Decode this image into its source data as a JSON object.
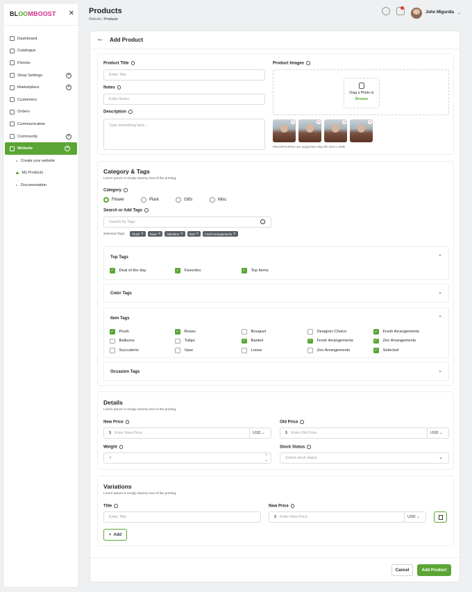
{
  "app": {
    "logo_parts": [
      "BL",
      "OO",
      "MBOOST"
    ],
    "close_icon": "close-icon"
  },
  "sidebar": {
    "items": [
      {
        "label": "Dashboard",
        "icon": "grid-icon",
        "expandable": false
      },
      {
        "label": "Catalogue",
        "icon": "box-icon",
        "expandable": false
      },
      {
        "label": "Florists",
        "icon": "user-icon",
        "expandable": false
      },
      {
        "label": "Shop Settings",
        "icon": "gear-icon",
        "expandable": true
      },
      {
        "label": "Marketplace",
        "icon": "store-icon",
        "expandable": true
      },
      {
        "label": "Customers",
        "icon": "users-icon",
        "expandable": false
      },
      {
        "label": "Orders",
        "icon": "clipboard-icon",
        "expandable": false
      },
      {
        "label": "Communication",
        "icon": "chat-icon",
        "expandable": false
      },
      {
        "label": "Community",
        "icon": "megaphone-icon",
        "expandable": true
      },
      {
        "label": "Website",
        "icon": "globe-icon",
        "expandable": true,
        "active": true
      }
    ],
    "subitems": [
      {
        "label": "Create your website"
      },
      {
        "label": "My Products",
        "current": true
      },
      {
        "label": "Documentation"
      }
    ]
  },
  "header": {
    "title": "Products",
    "breadcrumb_root": "Website",
    "breadcrumb_sep": "/",
    "breadcrumb_current": "Products",
    "user_name": "John Migurdia",
    "accent": "#5aa534"
  },
  "page": {
    "back_icon": "arrow-left-icon",
    "title": "Add Product"
  },
  "product": {
    "title_label": "Product Title",
    "title_placeholder": "Enter Title",
    "notes_label": "Notes",
    "notes_placeholder": "Enter Notes",
    "desc_label": "Description",
    "desc_placeholder": "Type something here...",
    "images_label": "Product Images",
    "drop_text": "Drag a Photo or",
    "browse": "Browse",
    "images_hint": "PNG/JPG/JPEG are supported. Max file size is 2MB"
  },
  "category": {
    "title": "Category & Tags",
    "subtitle": "Lorem Ipsum is simply dummy text of the printing.",
    "category_label": "Category",
    "options": [
      {
        "label": "Flower",
        "selected": true
      },
      {
        "label": "Plant"
      },
      {
        "label": "Gifts"
      },
      {
        "label": "Misc"
      }
    ],
    "search_label": "Search or Add Tags",
    "search_placeholder": "Search by Tags",
    "selected_label": "Selected Tags:",
    "selected_tags": [
      "Plush",
      "Rose",
      "Valentine",
      "Red",
      "Fresh Arrangements"
    ],
    "top_tags_title": "Top Tags",
    "top_tags": [
      {
        "label": "Deal of the day",
        "checked": true
      },
      {
        "label": "Favorites",
        "checked": true
      },
      {
        "label": "Top Items",
        "checked": true
      }
    ],
    "color_tags_title": "Color Tags",
    "item_tags_title": "Item Tags",
    "item_tags": [
      {
        "label": "Plush",
        "checked": true
      },
      {
        "label": "Roses",
        "checked": true
      },
      {
        "label": "Bouquet",
        "checked": false
      },
      {
        "label": "Designer Choice",
        "checked": false
      },
      {
        "label": "Fresh Arrangements",
        "checked": true
      },
      {
        "label": "Balloons",
        "checked": false
      },
      {
        "label": "Tulips",
        "checked": false
      },
      {
        "label": "Basket",
        "checked": true
      },
      {
        "label": "Fresh Arrangements",
        "checked": true
      },
      {
        "label": "Zen Arrangements",
        "checked": true
      },
      {
        "label": "Succulents",
        "checked": false
      },
      {
        "label": "Vase",
        "checked": false
      },
      {
        "label": "Loose",
        "checked": false
      },
      {
        "label": "Zen Arrangements",
        "checked": false
      },
      {
        "label": "Selected",
        "checked": true
      }
    ],
    "occasion_tags_title": "Occasion Tags"
  },
  "details": {
    "title": "Details",
    "subtitle": "Lorem Ipsum is simply dummy text of the printing.",
    "new_price_label": "New Price",
    "new_price_placeholder": "Enter New Price",
    "old_price_label": "Old Price",
    "old_price_placeholder": "Enter Old Price",
    "currency_symbol": "$",
    "currency": "USD",
    "weight_label": "Weight",
    "weight_value": "4",
    "stock_label": "Stock Status",
    "stock_placeholder": "Select stock status"
  },
  "variations": {
    "title": "Variations",
    "subtitle": "Lorem Ipsum is simply dummy text of the printing.",
    "title_label": "Title",
    "title_placeholder": "Enter Title",
    "price_label": "New Price",
    "price_placeholder": "Enter New Price",
    "add_label": "Add"
  },
  "footer": {
    "cancel": "Cancel",
    "submit": "Add Product"
  }
}
